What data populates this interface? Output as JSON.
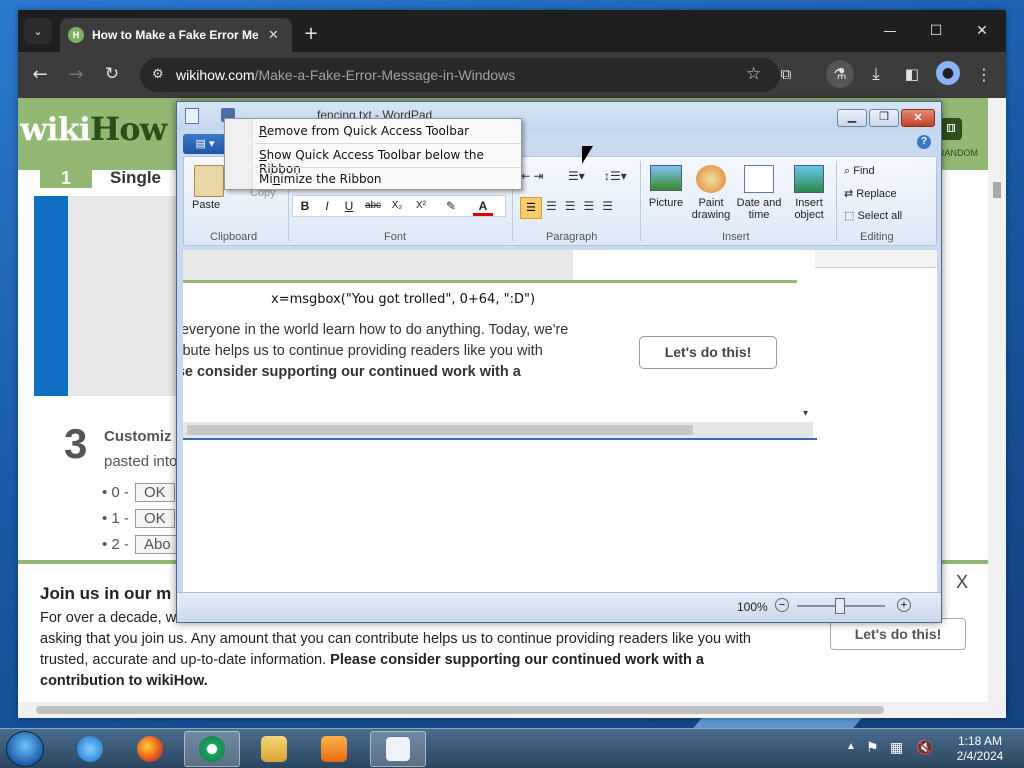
{
  "browser": {
    "tab_title": "How to Make a Fake Error Mes",
    "tab_close": "✕",
    "new_tab": "+",
    "url_host": "wikihow.com",
    "url_path": "/Make-a-Fake-Error-Message-in-Windows",
    "window_controls": {
      "minimize": "—",
      "maximize": "☐",
      "close": "✕"
    }
  },
  "wikihow": {
    "logo_left": "wiki",
    "logo_right": "How",
    "step1_number": "1",
    "step1_title": "Single",
    "random_label": "RANDOM",
    "step3_number": "3",
    "step3_title": "Customiz",
    "step3_sub": "pasted into",
    "bullets": [
      {
        "num": "0 -",
        "btn": "OK"
      },
      {
        "num": "1 -",
        "btn": "OK"
      },
      {
        "num": "2 -",
        "btn": "Abo"
      }
    ],
    "banner": {
      "title": "Join us in our m",
      "text1": "For over a decade, w",
      "text2": "asking that you join us. Any amount that you can contribute helps us to continue providing readers like you with",
      "text3": "trusted, accurate and up-to-date information.",
      "text_bold": "Please consider supporting our continued work with a contribution to wikiHow.",
      "button": "Let's do this!",
      "close": "X"
    }
  },
  "wordpad": {
    "title": "fencing.txt - WordPad",
    "file_tab": "▤ ▾",
    "groups": {
      "clipboard": "Clipboard",
      "font": "Font",
      "paragraph": "Paragraph",
      "insert": "Insert",
      "editing": "Editing"
    },
    "paste_label": "Paste",
    "copy_label": "Copy",
    "picture_label": "Picture",
    "paint_label": "Paint drawing",
    "datetime_label": "Date and time",
    "object_label": "Insert object",
    "find_label": "Find",
    "replace_label": "Replace",
    "selectall_label": "Select all",
    "format_buttons": [
      "B",
      "I",
      "U",
      "abc",
      "X₂",
      "X²"
    ],
    "doc_code": "x=msgbox(\"You got trolled\", 0+64, \":D\")",
    "doc_line1": "Help everyone in the world learn how to do anything. Today, we're",
    "doc_line2": "contribute helps us to continue providing readers like you with",
    "doc_line3": "Please consider supporting our continued work with a",
    "doc_button": "Let's do this!",
    "zoom": "100%",
    "zoom_minus": "−",
    "zoom_plus": "+",
    "help": "?"
  },
  "qat_menu": {
    "items": [
      {
        "pre": "",
        "key": "R",
        "rest": "emove from Quick Access Toolbar"
      },
      {
        "pre": "",
        "key": "S",
        "rest": "how Quick Access Toolbar below the Ribbon"
      },
      {
        "pre": "Mi",
        "key": "n",
        "rest": "imize the Ribbon"
      }
    ]
  },
  "taskbar": {
    "time": "1:18 AM",
    "date": "2/4/2024"
  },
  "colors": {
    "wikihow_green": "#93b874",
    "chrome_dark": "#3c3c3c",
    "wordpad_frame": "#c9daf0"
  }
}
